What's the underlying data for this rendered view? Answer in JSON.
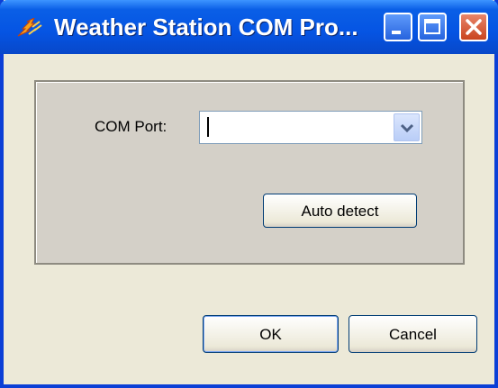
{
  "window": {
    "title": "Weather Station COM Pro...",
    "app_icon": "app-icon",
    "minimize_icon": "minimize-icon",
    "maximize_icon": "maximize-icon",
    "close_icon": "close-icon"
  },
  "form": {
    "com_port_label": "COM Port:",
    "com_port_value": "",
    "dropdown_icon": "chevron-down-icon",
    "auto_detect_label": "Auto detect"
  },
  "actions": {
    "ok_label": "OK",
    "cancel_label": "Cancel"
  },
  "colors": {
    "title_bar": "#0554e3",
    "window_bg": "#ece9d8",
    "group_bg": "#d4d0c8",
    "close_button": "#c9441f"
  }
}
